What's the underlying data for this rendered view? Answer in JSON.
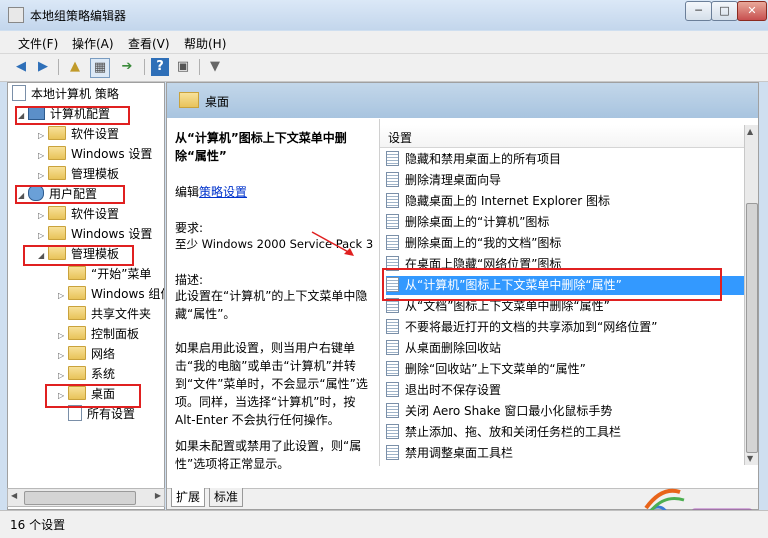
{
  "window": {
    "title": "本地组策略编辑器",
    "min_label": "─",
    "max_label": "□",
    "close_label": "✕"
  },
  "menu": [
    {
      "label": "文件(F)"
    },
    {
      "label": "操作(A)"
    },
    {
      "label": "查看(V)"
    },
    {
      "label": "帮助(H)"
    }
  ],
  "toolbar": [
    {
      "glyph": "◀"
    },
    {
      "glyph": "▶"
    },
    {
      "glyph": "▲"
    },
    {
      "glyph": "▦"
    },
    {
      "glyph": "➔"
    },
    {
      "glyph": "?"
    },
    {
      "glyph": "▣"
    },
    {
      "glyph": "▼"
    }
  ],
  "tree": {
    "root": "本地计算机 策略",
    "items": [
      {
        "label": "计算机配置"
      },
      {
        "label": "软件设置"
      },
      {
        "label": "Windows 设置"
      },
      {
        "label": "管理模板"
      },
      {
        "label": "用户配置"
      },
      {
        "label": "软件设置"
      },
      {
        "label": "Windows 设置"
      },
      {
        "label": "管理模板"
      },
      {
        "label": "“开始”菜单"
      },
      {
        "label": "Windows 组件"
      },
      {
        "label": "共享文件夹"
      },
      {
        "label": "控制面板"
      },
      {
        "label": "网络"
      },
      {
        "label": "系统"
      },
      {
        "label": "桌面"
      },
      {
        "label": "所有设置"
      }
    ]
  },
  "right": {
    "header_title": "桌面",
    "desc": {
      "title": "从“计算机”图标上下文菜单中删除“属性”",
      "edit_prefix": "编辑",
      "edit_link": "策略设置",
      "req_label": "要求:",
      "req_text": "至少 Windows 2000 Service Pack 3",
      "desc_label": "描述:",
      "desc_text": "此设置在“计算机”的上下文菜单中隐藏“属性”。",
      "enabled_text": "如果启用此设置，则当用户右键单击“我的电脑”或单击“计算机”并转到“文件”菜单时，不会显示“属性”选项。同样，当选择“计算机”时，按 Alt-Enter 不会执行任何操作。",
      "disabled_text": "如果未配置或禁用了此设置，则“属性”选项将正常显示。"
    },
    "column_header": "设置",
    "settings": [
      {
        "label": "隐藏和禁用桌面上的所有项目"
      },
      {
        "label": "删除清理桌面向导"
      },
      {
        "label": "隐藏桌面上的 Internet Explorer 图标"
      },
      {
        "label": "删除桌面上的“计算机”图标"
      },
      {
        "label": "删除桌面上的“我的文档”图标"
      },
      {
        "label": "在桌面上隐藏“网络位置”图标"
      },
      {
        "label": "从“计算机”图标上下文菜单中删除“属性”"
      },
      {
        "label": "从“文档”图标上下文菜单中删除“属性”"
      },
      {
        "label": "不要将最近打开的文档的共享添加到“网络位置”"
      },
      {
        "label": "从桌面删除回收站"
      },
      {
        "label": "删除“回收站”上下文菜单的“属性”"
      },
      {
        "label": "退出时不保存设置"
      },
      {
        "label": "关闭 Aero Shake 窗口最小化鼠标手势"
      },
      {
        "label": "禁止添加、拖、放和关闭任务栏的工具栏"
      },
      {
        "label": "禁用调整桌面工具栏"
      }
    ],
    "tabs": [
      {
        "label": "扩展"
      },
      {
        "label": "标准"
      }
    ]
  },
  "status": {
    "text": "16 个设置"
  },
  "colors": {
    "selection": "#3399ff",
    "highlight_box": "#e02020",
    "header": "#b8cfe6"
  }
}
